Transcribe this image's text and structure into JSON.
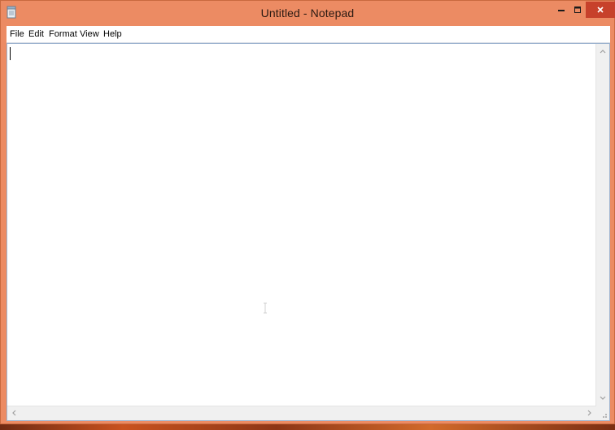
{
  "window": {
    "title": "Untitled - Notepad",
    "accent": "#ec8b63",
    "close_color": "#c7412b"
  },
  "titlebar_controls": [
    {
      "name": "minimize",
      "icon": "minimize-icon"
    },
    {
      "name": "maximize",
      "icon": "maximize-icon"
    },
    {
      "name": "close",
      "icon": "close-icon"
    }
  ],
  "menu": {
    "items": [
      {
        "label": "File"
      },
      {
        "label": "Edit"
      },
      {
        "label": "Format"
      },
      {
        "label": "View"
      },
      {
        "label": "Help"
      }
    ]
  },
  "editor": {
    "content": "",
    "icons": {
      "scroll_up": "chevron-up-icon",
      "scroll_down": "chevron-down-icon",
      "scroll_left": "chevron-left-icon",
      "scroll_right": "chevron-right-icon",
      "resize_grip": "resize-grip-icon"
    }
  }
}
